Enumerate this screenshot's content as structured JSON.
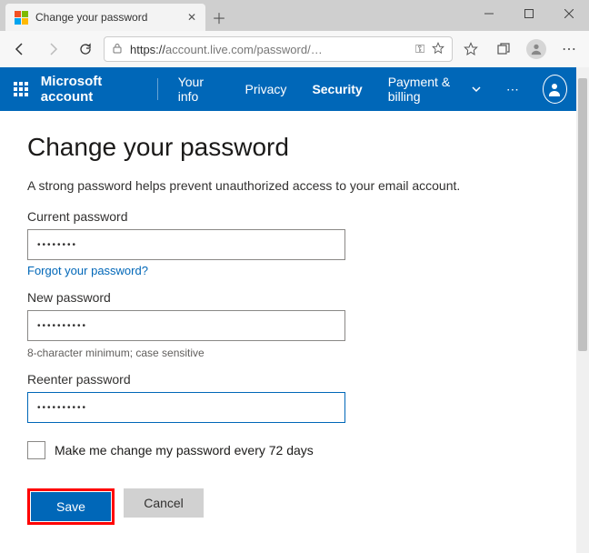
{
  "browser": {
    "tab_title": "Change your password",
    "url_display": "account.live.com/password/…",
    "protocol": "https://"
  },
  "nav": {
    "brand": "Microsoft account",
    "items": [
      "Your info",
      "Privacy",
      "Security",
      "Payment & billing"
    ],
    "active_index": 2
  },
  "page": {
    "heading": "Change your password",
    "description": "A strong password helps prevent unauthorized access to your email account.",
    "current_label": "Current password",
    "current_value": "••••••••",
    "forgot_link": "Forgot your password?",
    "new_label": "New password",
    "new_value": "••••••••••",
    "hint": "8-character minimum; case sensitive",
    "reenter_label": "Reenter password",
    "reenter_value": "••••••••••",
    "checkbox_label": "Make me change my password every 72 days",
    "save": "Save",
    "cancel": "Cancel"
  }
}
